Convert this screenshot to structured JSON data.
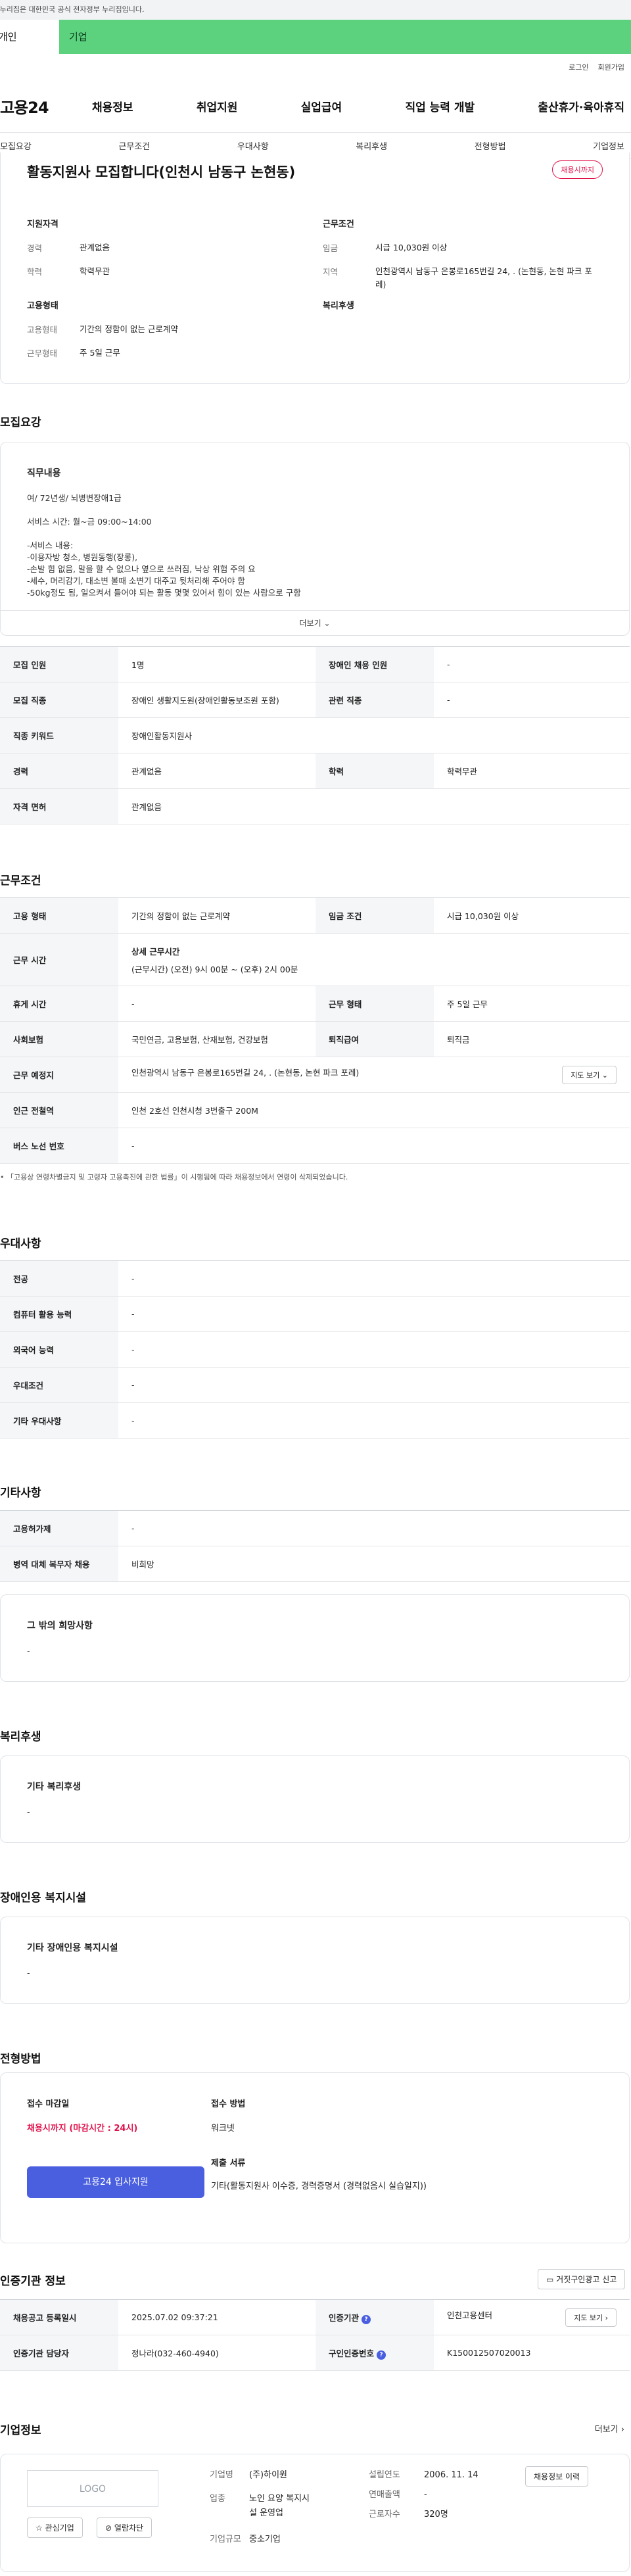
{
  "banner": {
    "gov_notice": "이 누리집은 대한민국 공식 전자정부 누리집입니다.",
    "persona_left": "개인",
    "persona_right": "기업"
  },
  "util": {
    "login": "로그인",
    "join": "회원가입"
  },
  "gnb": {
    "logo": "고용24",
    "items": [
      "채용정보",
      "취업지원",
      "실업급여",
      "직업 능력 개발",
      "출산휴가·육아휴직"
    ]
  },
  "subnav": [
    "모집요강",
    "근무조건",
    "우대사항",
    "복리후생",
    "전형방법",
    "기업정보"
  ],
  "summary": {
    "title": "활동지원사 모집합니다(인천시 남동구 논현동)",
    "badge": "채용시까지",
    "qual_head": "지원자격",
    "career_k": "경력",
    "career_v": "관계없음",
    "edu_k": "학력",
    "edu_v": "학력무관",
    "cond_head": "근무조건",
    "wage_k": "임금",
    "wage_v": "시급 10,030원 이상",
    "region_k": "지역",
    "region_v": "인천광역시 남동구 은봉로165번길 24, . (논현동, 논현 파크 포레)",
    "emp_head": "고용형태",
    "emptype_k": "고용형태",
    "emptype_v": "기간의 정함이 없는 근로계약",
    "worktype_k": "근무형태",
    "worktype_v": "주 5일 근무",
    "welfare_head": "복리후생"
  },
  "recruit": {
    "title": "모집요강",
    "duty_head": "직무내용",
    "duty_lines": [
      "여/ 72년생/ 뇌병변장애1급",
      "",
      "서비스 시간: 월~금 09:00~14:00",
      "",
      "-서비스 내용:",
      "-이용자방 청소, 병원동행(장롱),",
      "-손발 힘 없음, 말을 할 수 없으나 옆으로 쓰러짐, 낙상 위험 주의 요",
      "-세수, 머리감기, 대소변 볼때 소변기 대주고 뒷처리해 주어야 함",
      "-50kg정도 됨, 일으켜서 들어야 되는 활동 몇몇 있어서 힘이 있는 사람으로 구함"
    ],
    "more": "더보기",
    "rows": {
      "people_k": "모집 인원",
      "people_v": "1명",
      "disabled_k": "장애인 채용 인원",
      "disabled_v": "-",
      "job_k": "모집 직종",
      "job_v": "장애인 생활지도원(장애인활동보조원 포함)",
      "related_k": "관련 직종",
      "related_v": "-",
      "keyword_k": "직종 키워드",
      "keyword_v": "장애인활동지원사",
      "career_k": "경력",
      "career_v": "관계없음",
      "edu_k": "학력",
      "edu_v": "학력무관",
      "license_k": "자격 면허",
      "license_v": "관계없음"
    }
  },
  "work": {
    "title": "근무조건",
    "emptype_k": "고용 형태",
    "emptype_v": "기간의 정함이 없는 근로계약",
    "wage_k": "임금 조건",
    "wage_v": "시급 10,030원 이상",
    "hours_k": "근무 시간",
    "hours_sub": "상세 근무시간",
    "hours_v": "(근무시간) (오전) 9시 00분 ~ (오후) 2시 00분",
    "rest_k": "휴게 시간",
    "rest_v": "-",
    "worktype_k": "근무 형태",
    "worktype_v": "주 5일 근무",
    "insurance_k": "사회보험",
    "insurance_v": "국민연금, 고용보험, 산재보험, 건강보험",
    "retire_k": "퇴직급여",
    "retire_v": "퇴직금",
    "place_k": "근무 예정지",
    "place_v": "인천광역시 남동구 은봉로165번길 24, . (논현동, 논현 파크 포레)",
    "map_btn": "지도 보기",
    "subway_k": "인근 전철역",
    "subway_v": "인천 2호선 인천시청 3번출구 200M",
    "bus_k": "버스 노선 번호",
    "bus_v": "-",
    "note": "「고용상 연령차별금지 및 고령자 고용촉진에 관한 법률」이 시행됨에 따라 채용정보에서 연령이 삭제되었습니다."
  },
  "pref": {
    "title": "우대사항",
    "major_k": "전공",
    "major_v": "-",
    "computer_k": "컴퓨터 활용 능력",
    "computer_v": "-",
    "lang_k": "외국어 능력",
    "lang_v": "-",
    "cond_k": "우대조건",
    "cond_v": "-",
    "etc_k": "기타 우대사항",
    "etc_v": "-"
  },
  "etc": {
    "title": "기타사항",
    "permit_k": "고용허가제",
    "permit_v": "-",
    "military_k": "병역 대체 복무자 채용",
    "military_v": "비희망",
    "other_head": "그 밖의 희망사항",
    "other_v": "-"
  },
  "welfare": {
    "title": "복리후생",
    "head": "기타 복리후생",
    "v": "-"
  },
  "facility": {
    "title": "장애인용 복지시설",
    "head": "기타 장애인용 복지시설",
    "v": "-"
  },
  "apply": {
    "title": "전형방법",
    "deadline_head": "접수 마감일",
    "deadline_v": "채용시까지 (마감시간 : 24시)",
    "btn": "고용24 입사지원",
    "method_head": "접수 방법",
    "method_v": "워크넷",
    "docs_head": "제출 서류",
    "docs_v": "기타(활동지원사 이수증, 경력증명서 (경력없음시 실습일지))"
  },
  "agency": {
    "title": "인증기관 정보",
    "report_btn": "거짓구인광고 신고",
    "reg_k": "채용공고 등록일시",
    "reg_v": "2025.07.02 09:37:21",
    "agency_k": "인증기관",
    "agency_v": "인천고용센터",
    "map_btn": "지도 보기",
    "manager_k": "인증기관 담당자",
    "manager_v": "정나라(032-460-4940)",
    "auth_k": "구인인증번호",
    "auth_v": "K150012507020013"
  },
  "company": {
    "title": "기업정보",
    "more": "더보기",
    "logo": "LOGO",
    "fav_btn": "관심기업",
    "block_btn": "열람차단",
    "name_k": "기업명",
    "name_v": "(주)하이원",
    "industry_k": "업종",
    "industry_v1": "노인 요양 복지시",
    "industry_v2": "설 운영업",
    "scale_k": "기업규모",
    "scale_v": "중소기업",
    "founded_k": "설립연도",
    "founded_v": "2006. 11. 14",
    "sales_k": "연매출액",
    "sales_v": "-",
    "staff_k": "근로자수",
    "staff_v": "320명",
    "other_jobs_btn": "채용정보 이력"
  }
}
